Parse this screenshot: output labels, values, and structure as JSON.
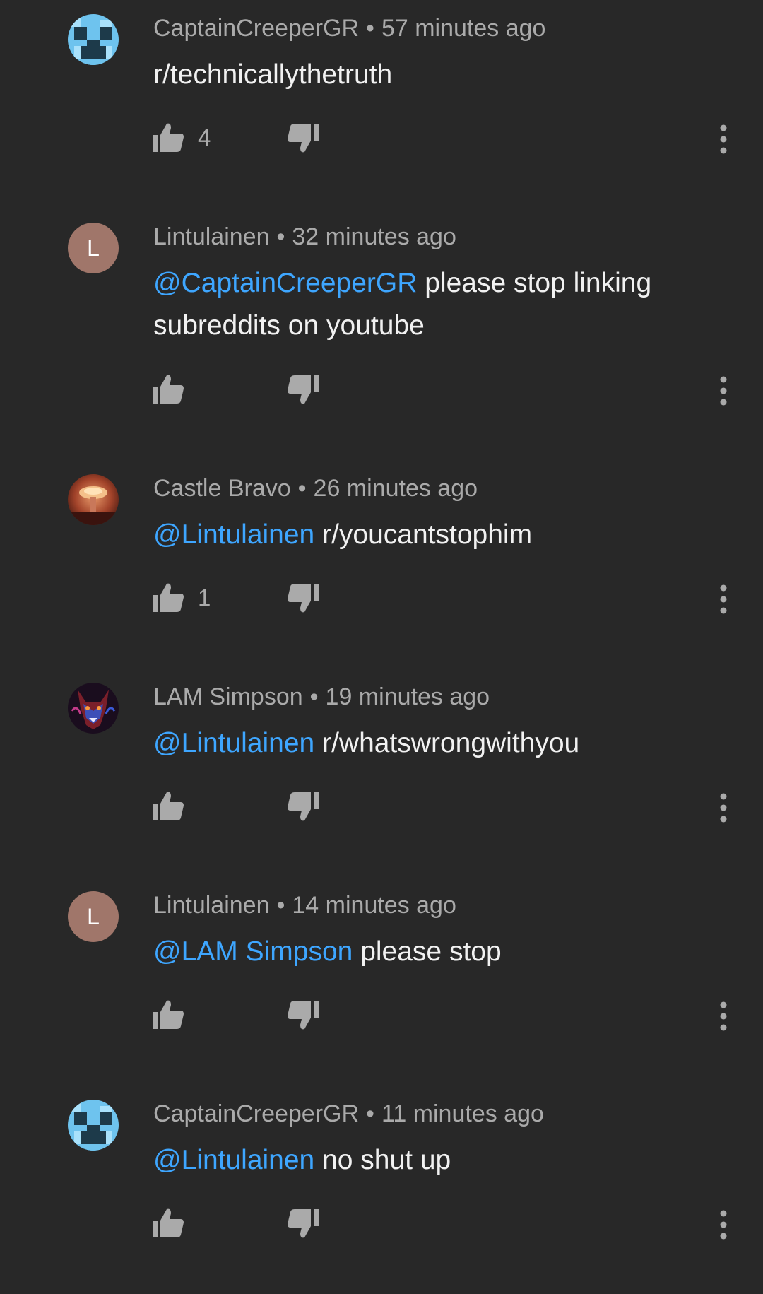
{
  "colors": {
    "background": "#282828",
    "mention": "#3ea6ff",
    "meta_text": "#aaaaaa",
    "body_text": "#f1f1f1",
    "letter_avatar": "#a0766a"
  },
  "separator": "•",
  "comments": [
    {
      "author": "CaptainCreeperGR",
      "time": "57 minutes ago",
      "avatar": "creeper-avatar",
      "mention": "",
      "text": "r/technicallythetruth",
      "likes": "4"
    },
    {
      "author": "Lintulainen",
      "time": "32 minutes ago",
      "avatar": "L",
      "mention": "@CaptainCreeperGR",
      "text": " please stop linking subreddits on youtube",
      "likes": ""
    },
    {
      "author": "Castle Bravo",
      "time": "26 minutes ago",
      "avatar": "mushroom-cloud-avatar",
      "mention": "@Lintulainen",
      "text": " r/youcantstophim",
      "likes": "1"
    },
    {
      "author": "LAM Simpson",
      "time": "19 minutes ago",
      "avatar": "wolf-avatar",
      "mention": "@Lintulainen",
      "text": " r/whatswrongwithyou",
      "likes": ""
    },
    {
      "author": "Lintulainen",
      "time": "14 minutes ago",
      "avatar": "L",
      "mention": "@LAM Simpson",
      "text": " please stop",
      "likes": ""
    },
    {
      "author": "CaptainCreeperGR",
      "time": "11 minutes ago",
      "avatar": "creeper-avatar",
      "mention": "@Lintulainen",
      "text": " no shut up",
      "likes": ""
    }
  ]
}
